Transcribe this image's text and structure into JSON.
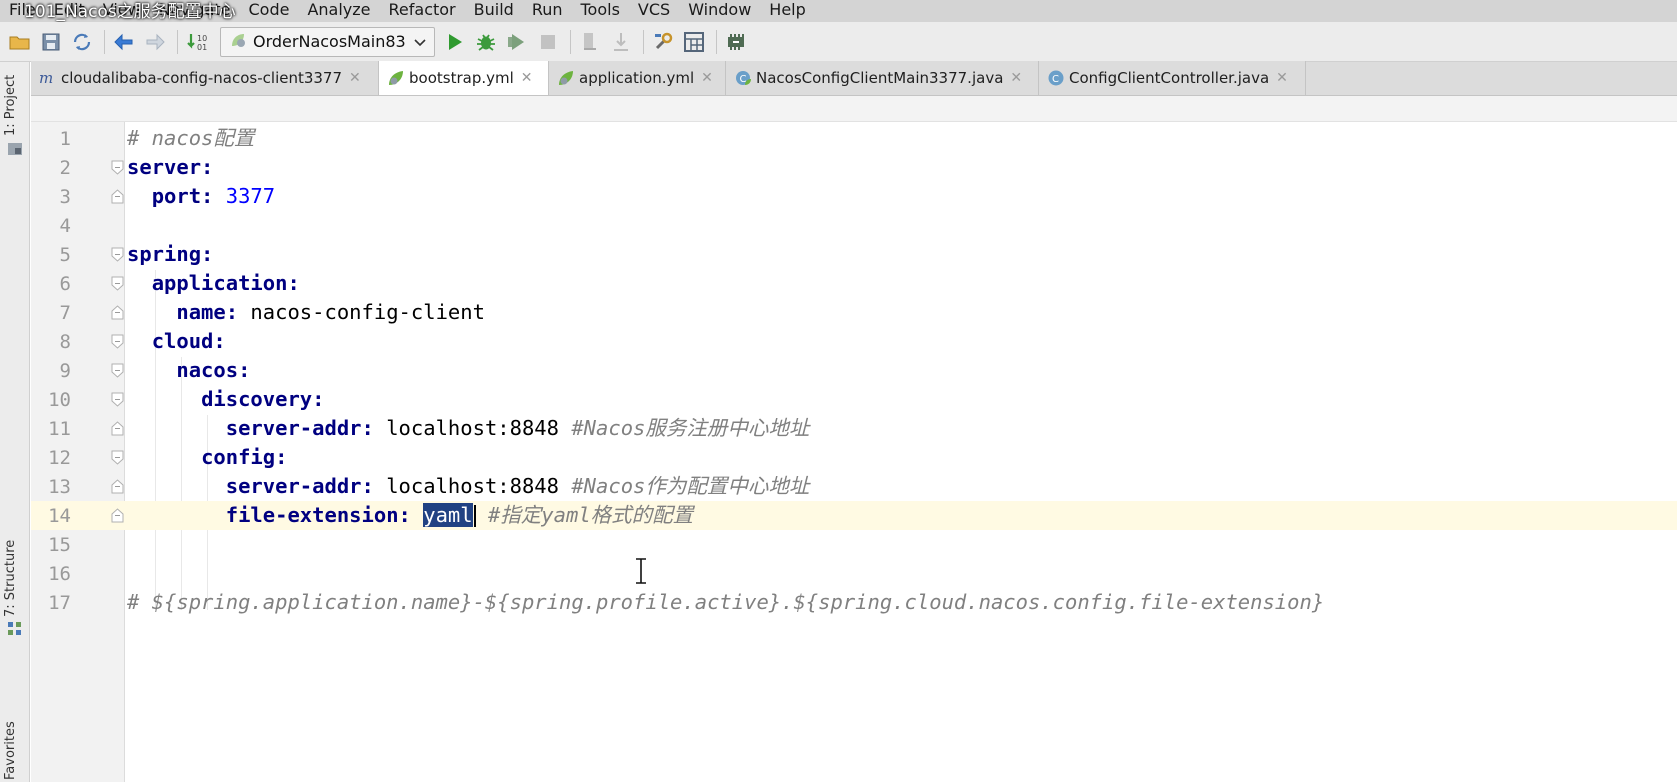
{
  "overlay_title": "101_Nacos之服务配置中心",
  "menu": [
    "File",
    "Edit",
    "View",
    "Navigate",
    "Code",
    "Analyze",
    "Refactor",
    "Build",
    "Run",
    "Tools",
    "VCS",
    "Window",
    "Help"
  ],
  "toolbar": {
    "run_config": "OrderNacosMain83"
  },
  "side_tabs": {
    "project": "1: Project",
    "structure": "7: Structure",
    "favorites": "Favorites"
  },
  "tabs": [
    {
      "label": "cloudalibaba-config-nacos-client3377",
      "icon": "maven-module-icon",
      "active": false
    },
    {
      "label": "bootstrap.yml",
      "icon": "spring-yml-icon",
      "active": true
    },
    {
      "label": "application.yml",
      "icon": "spring-yml-icon",
      "active": false
    },
    {
      "label": "NacosConfigClientMain3377.java",
      "icon": "spring-boot-class-icon",
      "active": false
    },
    {
      "label": "ConfigClientController.java",
      "icon": "java-class-icon",
      "active": false
    }
  ],
  "editor": {
    "current_line": 14,
    "lines": [
      {
        "n": "1",
        "comment": "# nacos配置"
      },
      {
        "n": "2",
        "key": "server:"
      },
      {
        "n": "3",
        "indent": "  ",
        "key": "port:",
        "num": " 3377"
      },
      {
        "n": "4"
      },
      {
        "n": "5",
        "key": "spring:"
      },
      {
        "n": "6",
        "indent": "  ",
        "key": "application:"
      },
      {
        "n": "7",
        "indent": "    ",
        "key": "name:",
        "value": " nacos-config-client"
      },
      {
        "n": "8",
        "indent": "  ",
        "key": "cloud:"
      },
      {
        "n": "9",
        "indent": "    ",
        "key": "nacos:"
      },
      {
        "n": "10",
        "indent": "      ",
        "key": "discovery:"
      },
      {
        "n": "11",
        "indent": "        ",
        "key": "server-addr:",
        "value": " localhost:8848 ",
        "comment": "#Nacos服务注册中心地址"
      },
      {
        "n": "12",
        "indent": "      ",
        "key": "config:"
      },
      {
        "n": "13",
        "indent": "        ",
        "key": "server-addr:",
        "value": " localhost:8848 ",
        "comment": "#Nacos作为配置中心地址"
      },
      {
        "n": "14",
        "indent": "        ",
        "key": "file-extension:",
        "value": " ",
        "selected": "yaml",
        "comment": " #指定yaml格式的配置"
      },
      {
        "n": "15"
      },
      {
        "n": "16"
      },
      {
        "n": "17",
        "comment": "# ${spring.application.name}-${spring.profile.active}.${spring.cloud.nacos.config.file-extension}"
      }
    ]
  }
}
